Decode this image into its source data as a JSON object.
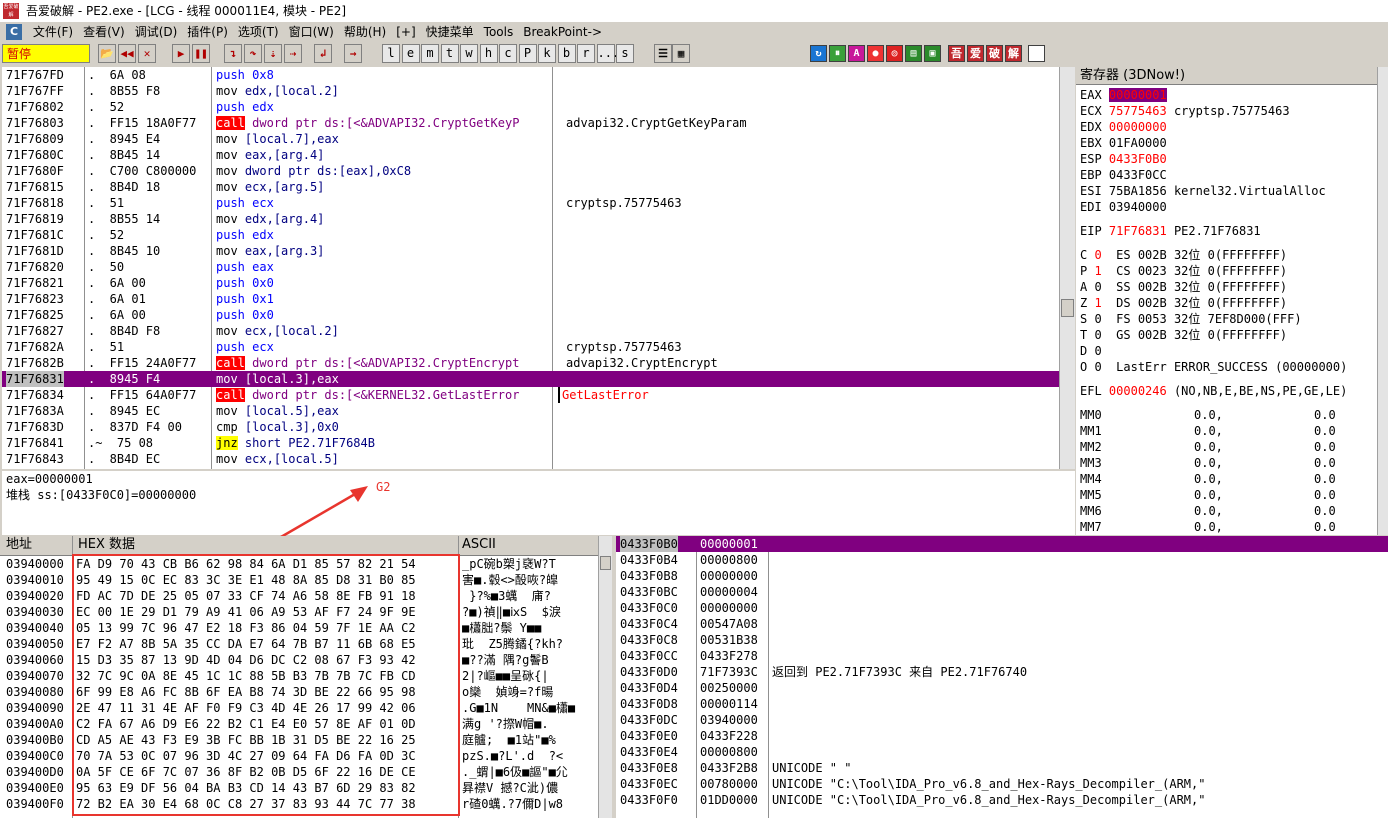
{
  "window": {
    "title": "吾爱破解 - PE2.exe - [LCG - 线程  000011E4, 模块 - PE2]",
    "icon_text": "吾爱破解"
  },
  "menu": [
    "文件(F)",
    "查看(V)",
    "调试(D)",
    "插件(P)",
    "选项(T)",
    "窗口(W)",
    "帮助(H)",
    "[+]",
    "快捷菜单",
    "Tools",
    "BreakPoint->"
  ],
  "menu_icon": "C",
  "toolbar": {
    "status": "暂停",
    "letters": [
      "l",
      "e",
      "m",
      "t",
      "w",
      "h",
      "c",
      "P",
      "k",
      "b",
      "r",
      "...",
      "s"
    ],
    "right_icons": [
      "吾",
      "爱",
      "破",
      "解"
    ]
  },
  "disasm": [
    {
      "addr": "71F767FD",
      "mk": ".",
      "hex": "6A 08",
      "op": "push",
      "args": "0x8",
      "cmt": ""
    },
    {
      "addr": "71F767FF",
      "mk": ".",
      "hex": "8B55 F8",
      "op": "mov",
      "args": "edx,[local.2]",
      "cmt": ""
    },
    {
      "addr": "71F76802",
      "mk": ".",
      "hex": "52",
      "op": "push",
      "args": "edx",
      "cmt": ""
    },
    {
      "addr": "71F76803",
      "mk": ".",
      "hex": "FF15 18A0F77",
      "op": "call",
      "args": "dword ptr ds:[<&ADVAPI32.CryptGetKeyP",
      "cmt": "advapi32.CryptGetKeyParam"
    },
    {
      "addr": "71F76809",
      "mk": ".",
      "hex": "8945 E4",
      "op": "mov",
      "args": "[local.7],eax",
      "cmt": ""
    },
    {
      "addr": "71F7680C",
      "mk": ".",
      "hex": "8B45 14",
      "op": "mov",
      "args": "eax,[arg.4]",
      "cmt": ""
    },
    {
      "addr": "71F7680F",
      "mk": ".",
      "hex": "C700 C800000",
      "op": "mov",
      "args": "dword ptr ds:[eax],0xC8",
      "cmt": ""
    },
    {
      "addr": "71F76815",
      "mk": ".",
      "hex": "8B4D 18",
      "op": "mov",
      "args": "ecx,[arg.5]",
      "cmt": ""
    },
    {
      "addr": "71F76818",
      "mk": ".",
      "hex": "51",
      "op": "push",
      "args": "ecx",
      "cmt": "cryptsp.75775463"
    },
    {
      "addr": "71F76819",
      "mk": ".",
      "hex": "8B55 14",
      "op": "mov",
      "args": "edx,[arg.4]",
      "cmt": ""
    },
    {
      "addr": "71F7681C",
      "mk": ".",
      "hex": "52",
      "op": "push",
      "args": "edx",
      "cmt": ""
    },
    {
      "addr": "71F7681D",
      "mk": ".",
      "hex": "8B45 10",
      "op": "mov",
      "args": "eax,[arg.3]",
      "cmt": ""
    },
    {
      "addr": "71F76820",
      "mk": ".",
      "hex": "50",
      "op": "push",
      "args": "eax",
      "cmt": ""
    },
    {
      "addr": "71F76821",
      "mk": ".",
      "hex": "6A 00",
      "op": "push",
      "args": "0x0",
      "cmt": ""
    },
    {
      "addr": "71F76823",
      "mk": ".",
      "hex": "6A 01",
      "op": "push",
      "args": "0x1",
      "cmt": ""
    },
    {
      "addr": "71F76825",
      "mk": ".",
      "hex": "6A 00",
      "op": "push",
      "args": "0x0",
      "cmt": ""
    },
    {
      "addr": "71F76827",
      "mk": ".",
      "hex": "8B4D F8",
      "op": "mov",
      "args": "ecx,[local.2]",
      "cmt": ""
    },
    {
      "addr": "71F7682A",
      "mk": ".",
      "hex": "51",
      "op": "push",
      "args": "ecx",
      "cmt": "cryptsp.75775463"
    },
    {
      "addr": "71F7682B",
      "mk": ".",
      "hex": "FF15 24A0F77",
      "op": "call",
      "args": "dword ptr ds:[<&ADVAPI32.CryptEncrypt",
      "cmt": "advapi32.CryptEncrypt"
    },
    {
      "addr": "71F76831",
      "mk": ".",
      "hex": "8945 F4",
      "op": "mov",
      "args": "[local.3],eax",
      "cmt": "",
      "selected": true
    },
    {
      "addr": "71F76834",
      "mk": ".",
      "hex": "FF15 64A0F77",
      "op": "call",
      "args": "dword ptr ds:[<&KERNEL32.GetLastError",
      "cmt": "GetLastError",
      "cmt_red": true
    },
    {
      "addr": "71F7683A",
      "mk": ".",
      "hex": "8945 EC",
      "op": "mov",
      "args": "[local.5],eax",
      "cmt": ""
    },
    {
      "addr": "71F7683D",
      "mk": ".",
      "hex": "837D F4 00",
      "op": "cmp",
      "args": "[local.3],0x0",
      "cmt": ""
    },
    {
      "addr": "71F76841",
      "mk": ".~",
      "hex": "75 08",
      "op": "jnz",
      "args": "short PE2.71F7684B",
      "cmt": ""
    },
    {
      "addr": "71F76843",
      "mk": ".",
      "hex": "8B4D EC",
      "op": "mov",
      "args": "ecx,[local.5]",
      "cmt": ""
    }
  ],
  "info": {
    "line1": "eax=00000001",
    "line2": "堆栈 ss:[0433F0C0]=00000000",
    "annotation": "G2"
  },
  "registers": {
    "title": "寄存器 (3DNow!)",
    "gp": [
      {
        "name": "EAX",
        "val": "00000001",
        "note": ""
      },
      {
        "name": "ECX",
        "val": "75775463",
        "note": "cryptsp.75775463"
      },
      {
        "name": "EDX",
        "val": "00000000",
        "note": ""
      },
      {
        "name": "EBX",
        "val": "01FA0000",
        "note": ""
      },
      {
        "name": "ESP",
        "val": "0433F0B0",
        "note": ""
      },
      {
        "name": "EBP",
        "val": "0433F0CC",
        "note": ""
      },
      {
        "name": "ESI",
        "val": "75BA1856",
        "note": "kernel32.VirtualAlloc"
      },
      {
        "name": "EDI",
        "val": "03940000",
        "note": ""
      }
    ],
    "eip": {
      "name": "EIP",
      "val": "71F76831",
      "note": "PE2.71F76831"
    },
    "flags": [
      {
        "f": "C",
        "v": "0",
        "seg": "ES 002B 32位 0(FFFFFFFF)"
      },
      {
        "f": "P",
        "v": "1",
        "seg": "CS 0023 32位 0(FFFFFFFF)"
      },
      {
        "f": "A",
        "v": "0",
        "seg": "SS 002B 32位 0(FFFFFFFF)"
      },
      {
        "f": "Z",
        "v": "1",
        "seg": "DS 002B 32位 0(FFFFFFFF)"
      },
      {
        "f": "S",
        "v": "0",
        "seg": "FS 0053 32位 7EF8D000(FFF)"
      },
      {
        "f": "T",
        "v": "0",
        "seg": "GS 002B 32位 0(FFFFFFFF)"
      },
      {
        "f": "D",
        "v": "0",
        "seg": ""
      },
      {
        "f": "O",
        "v": "0",
        "seg": "LastErr ERROR_SUCCESS (00000000)"
      }
    ],
    "efl": {
      "name": "EFL",
      "val": "00000246",
      "note": "(NO,NB,E,BE,NS,PE,GE,LE)"
    },
    "mm": [
      "MM0",
      "MM1",
      "MM2",
      "MM3",
      "MM4",
      "MM5",
      "MM6",
      "MM7"
    ],
    "mm_a": "0.0,",
    "mm_b": "0.0"
  },
  "hexdump": {
    "col_addr": "地址",
    "col_hex": "HEX 数据",
    "col_ascii": "ASCII",
    "rows": [
      {
        "a": "03940000",
        "h": "FA D9 70 43 CB B6 62 98 84 6A D1 85 57 82 21 54",
        "s": "_pC碗b槊j褎W?T"
      },
      {
        "a": "03940010",
        "h": "95 49 15 0C EC 83 3C 3E E1 48 8A 85 D8 31 B0 85",
        "s": "害■.毂<>酘咴?皡"
      },
      {
        "a": "03940020",
        "h": "FD AC 7D DE 25 05 07 33 CF 74 A6 58 8E FB 91 18",
        "s": " }?%■3蠇  庯?"
      },
      {
        "a": "03940030",
        "h": "EC 00 1E 29 D1 79 A9 41 06 A9 53 AF F7 24 9F 9E",
        "s": "?■)禎‖■ⅸS  $淚"
      },
      {
        "a": "03940040",
        "h": "05 13 99 7C 96 47 E2 18 F3 86 04 59 7F 1E AA C2",
        "s": "■櫹朏?鬃 Y■■"
      },
      {
        "a": "03940050",
        "h": "E7 F2 A7 8B 5A 35 CC DA E7 64 7B B7 11 6B 68 E5",
        "s": "玭  Z5腾鐍{?kh?"
      },
      {
        "a": "03940060",
        "h": "15 D3 35 87 13 9D 4D 04 D6 DC C2 08 67 F3 93 42",
        "s": "■??滿 隅?g鬠B"
      },
      {
        "a": "03940070",
        "h": "32 7C 9C 0A 8E 45 1C 1C 88 5B B3 7B 7B 7C FB CD",
        "s": "2|?嶇■■呈砯{|"
      },
      {
        "a": "03940080",
        "h": "6F 99 E8 A6 FC 8B 6F EA B8 74 3D BE 22 66 95 98",
        "s": "o欒  媜竧=?f暘"
      },
      {
        "a": "03940090",
        "h": "2E 47 11 31 4E AF F0 F9 C3 4D 4E 26 17 99 42 06",
        "s": ".G■1N    MN&■櫹■"
      },
      {
        "a": "039400A0",
        "h": "C2 FA 67 A6 D9 E6 22 B2 C1 E4 E0 57 8E AF 01 0D",
        "s": "满g '?摖W帽■."
      },
      {
        "a": "039400B0",
        "h": "CD A5 AE 43 F3 E9 3B FC BB 1B 31 D5 BE 22 16 25",
        "s": "庭髗;  ■1站\"■%"
      },
      {
        "a": "039400C0",
        "h": "70 7A 53 0C 07 96 3D 4C 27 09 64 FA D6 FA 0D 3C",
        "s": "pzS.■?L'.d  ?<"
      },
      {
        "a": "039400D0",
        "h": "0A 5F CE 6F 7C 07 36 8F B2 0B D5 6F 22 16 DE CE",
        "s": "._蝟|■6伋■謳\"■尣"
      },
      {
        "a": "039400E0",
        "h": "95 63 E9 DF 56 04 BA B3 CD 14 43 B7 6D 29 83 82",
        "s": "昪襟V 撼?C泚)儂"
      },
      {
        "a": "039400F0",
        "h": "72 B2 EA 30 E4 68 0C C8 27 37 83 93 44 7C 77 38",
        "s": "r碴0蠇.?7儞D|w8"
      }
    ]
  },
  "stack": [
    {
      "a": "0433F0B0",
      "v": "00000001",
      "c": "",
      "sel": true
    },
    {
      "a": "0433F0B4",
      "v": "00000800",
      "c": ""
    },
    {
      "a": "0433F0B8",
      "v": "00000000",
      "c": ""
    },
    {
      "a": "0433F0BC",
      "v": "00000004",
      "c": ""
    },
    {
      "a": "0433F0C0",
      "v": "00000000",
      "c": ""
    },
    {
      "a": "0433F0C4",
      "v": "00547A08",
      "c": ""
    },
    {
      "a": "0433F0C8",
      "v": "00531B38",
      "c": ""
    },
    {
      "a": "0433F0CC",
      "v": "0433F278",
      "c": ""
    },
    {
      "a": "0433F0D0",
      "v": "71F7393C",
      "c": "返回到 PE2.71F7393C 来自 PE2.71F76740"
    },
    {
      "a": "0433F0D4",
      "v": "00250000",
      "c": ""
    },
    {
      "a": "0433F0D8",
      "v": "00000114",
      "c": ""
    },
    {
      "a": "0433F0DC",
      "v": "03940000",
      "c": ""
    },
    {
      "a": "0433F0E0",
      "v": "0433F228",
      "c": ""
    },
    {
      "a": "0433F0E4",
      "v": "00000800",
      "c": ""
    },
    {
      "a": "0433F0E8",
      "v": "0433F2B8",
      "c": "UNICODE \" \""
    },
    {
      "a": "0433F0EC",
      "v": "00780000",
      "c": "UNICODE \"C:\\Tool\\IDA_Pro_v6.8_and_Hex-Rays_Decompiler_(ARM,\""
    },
    {
      "a": "0433F0F0",
      "v": "01DD0000",
      "c": "UNICODE \"C:\\Tool\\IDA_Pro_v6.8_and_Hex-Rays_Decompiler_(ARM,\""
    }
  ]
}
